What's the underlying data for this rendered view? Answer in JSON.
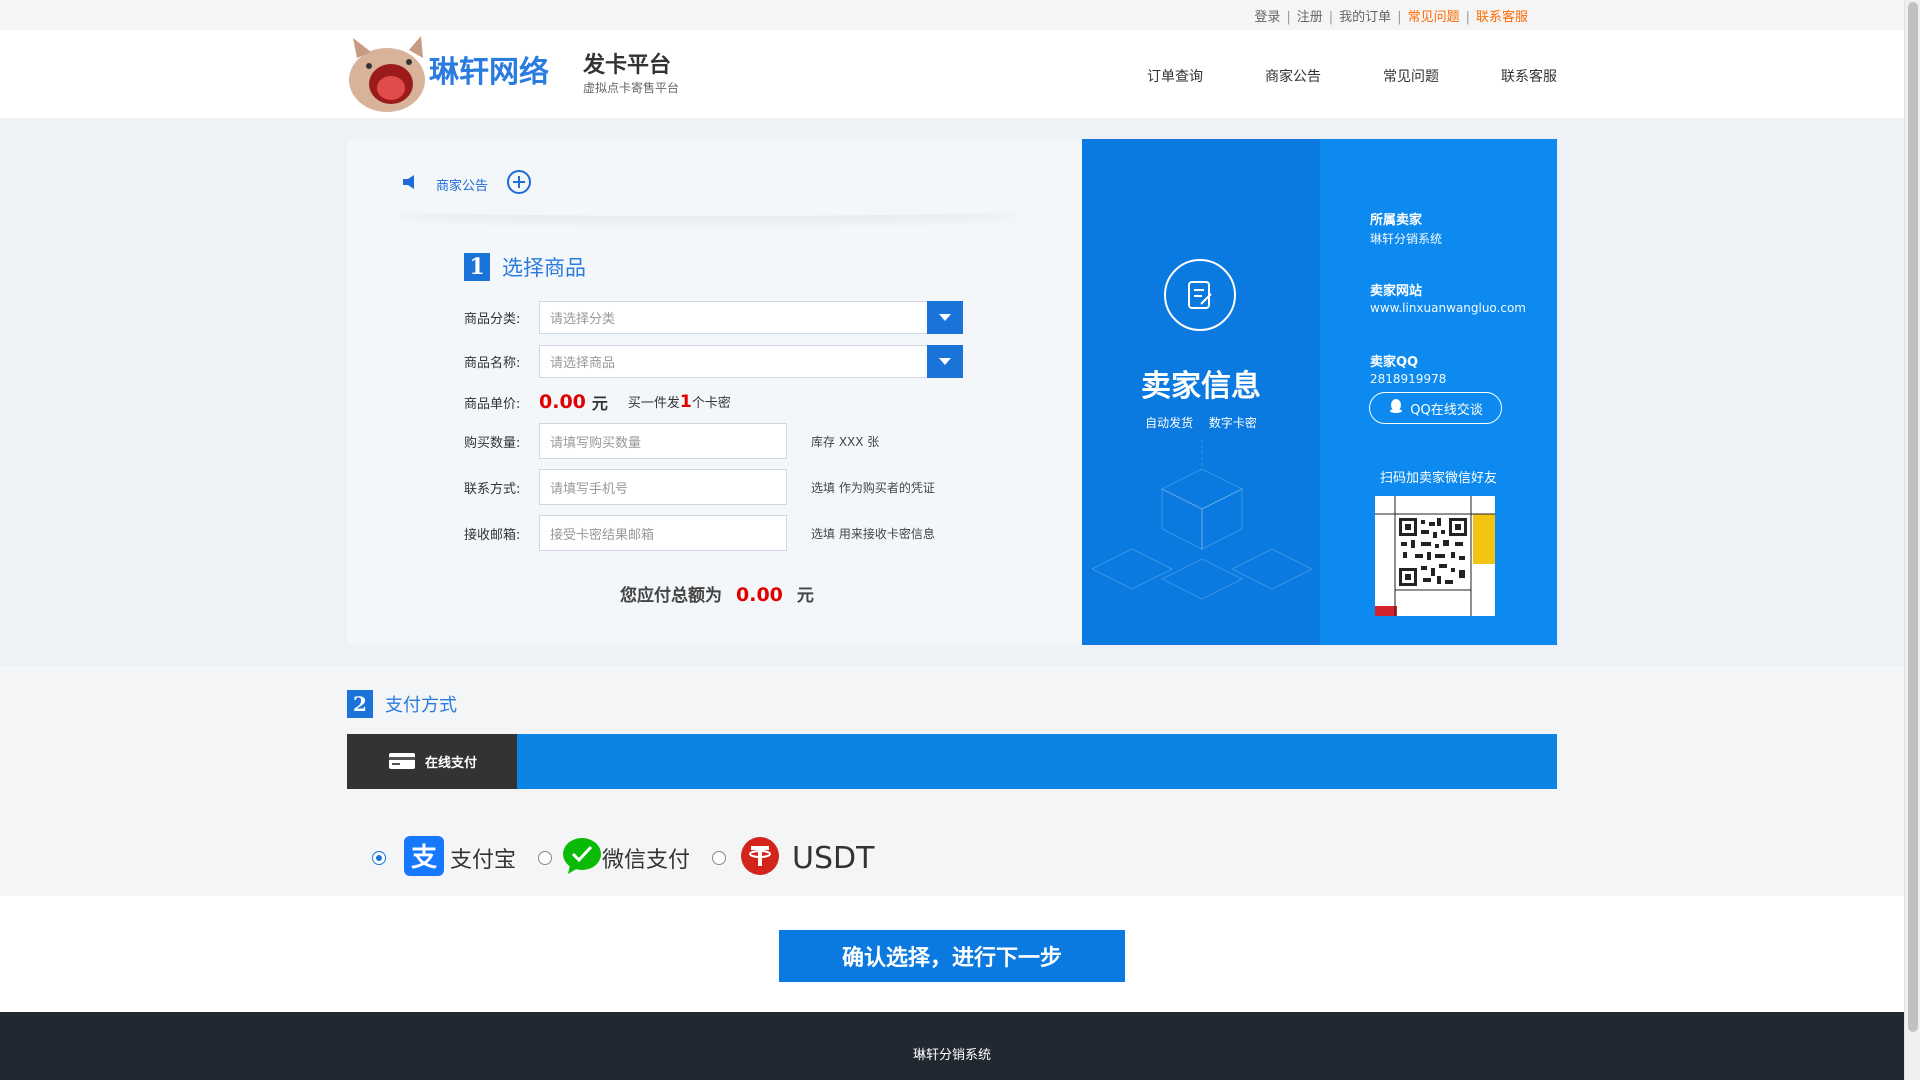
{
  "toplinks": {
    "login": "登录",
    "register": "注册",
    "my_orders": "我的订单",
    "faq": "常见问题",
    "support": "联系客服"
  },
  "logo": {
    "main": "琳轩网络",
    "badge": "发卡平台",
    "tagline": "虚拟点卡寄售平台"
  },
  "nav": [
    "订单查询",
    "商家公告",
    "常见问题",
    "联系客服"
  ],
  "notice": {
    "label": "商家公告"
  },
  "step1": {
    "num": "1",
    "title": "选择商品",
    "category": {
      "label": "商品分类:",
      "placeholder": "请选择分类"
    },
    "product": {
      "label": "商品名称:",
      "placeholder": "请选择商品"
    },
    "price": {
      "label": "商品单价:",
      "value": "0.00",
      "unit": "元",
      "tip_prefix": "买一件发",
      "tip_count": "1",
      "tip_suffix": "个卡密"
    },
    "quantity": {
      "label": "购买数量:",
      "placeholder": "请填写购买数量",
      "hint": "库存 XXX 张"
    },
    "contact": {
      "label": "联系方式:",
      "placeholder": "请填写手机号",
      "hint": "选填 作为购买者的凭证"
    },
    "email": {
      "label": "接收邮箱:",
      "placeholder": "接受卡密结果邮箱",
      "hint": "选填 用来接收卡密信息"
    },
    "total": {
      "label": "您应付总额为",
      "value": "0.00",
      "unit": "元"
    }
  },
  "seller": {
    "title": "卖家信息",
    "tags": [
      "自动发货",
      "数字卡密"
    ],
    "owner_key": "所属卖家",
    "owner_val": "琳轩分销系统",
    "site_key": "卖家网站",
    "site_val": "www.linxuanwangluo.com",
    "qq_key": "卖家QQ",
    "qq_val": "2818919978",
    "qq_button": "QQ在线交谈",
    "wechat_tip": "扫码加卖家微信好友"
  },
  "step2": {
    "num": "2",
    "title": "支付方式",
    "tab": "在线支付",
    "methods": [
      {
        "label": "支付宝",
        "selected": true,
        "icon": "alipay-icon",
        "color": "#1677ff"
      },
      {
        "label": "微信支付",
        "selected": false,
        "icon": "wechat-pay-icon",
        "color": "#09bb07"
      },
      {
        "label": "USDT",
        "selected": false,
        "icon": "usdt-icon",
        "color": "#d3241c"
      }
    ]
  },
  "confirm": "确认选择，进行下一步",
  "footer": "琳轩分销系统",
  "colors": {
    "accent": "#0a85e6",
    "price": "#e00000",
    "link_orange": "#ff6a00"
  }
}
